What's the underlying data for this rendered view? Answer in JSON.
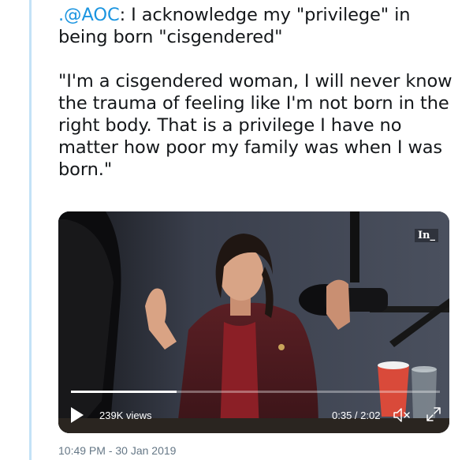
{
  "tweet": {
    "mention": ".@AOC",
    "headline_rest": ": I acknowledge my \"privilege\" in being born \"cisgendered\"",
    "quote": "\"I'm a cisgendered woman, I will never know the trauma of feeling like I'm not born in the right body. That is a privilege I have no matter how poor my family was when I was born.\"",
    "timestamp": "10:49 PM - 30 Jan 2019"
  },
  "video": {
    "brand_badge": "In_",
    "views": "239K views",
    "time": "0:35 / 2:02",
    "progress_fraction": 0.287,
    "play_icon": "play-icon",
    "mute_icon": "volume-muted-icon",
    "fullscreen_icon": "fullscreen-icon"
  },
  "colors": {
    "mention": "#1b95e0",
    "thread_line": "#c4e2f7",
    "timestamp": "#657786"
  }
}
